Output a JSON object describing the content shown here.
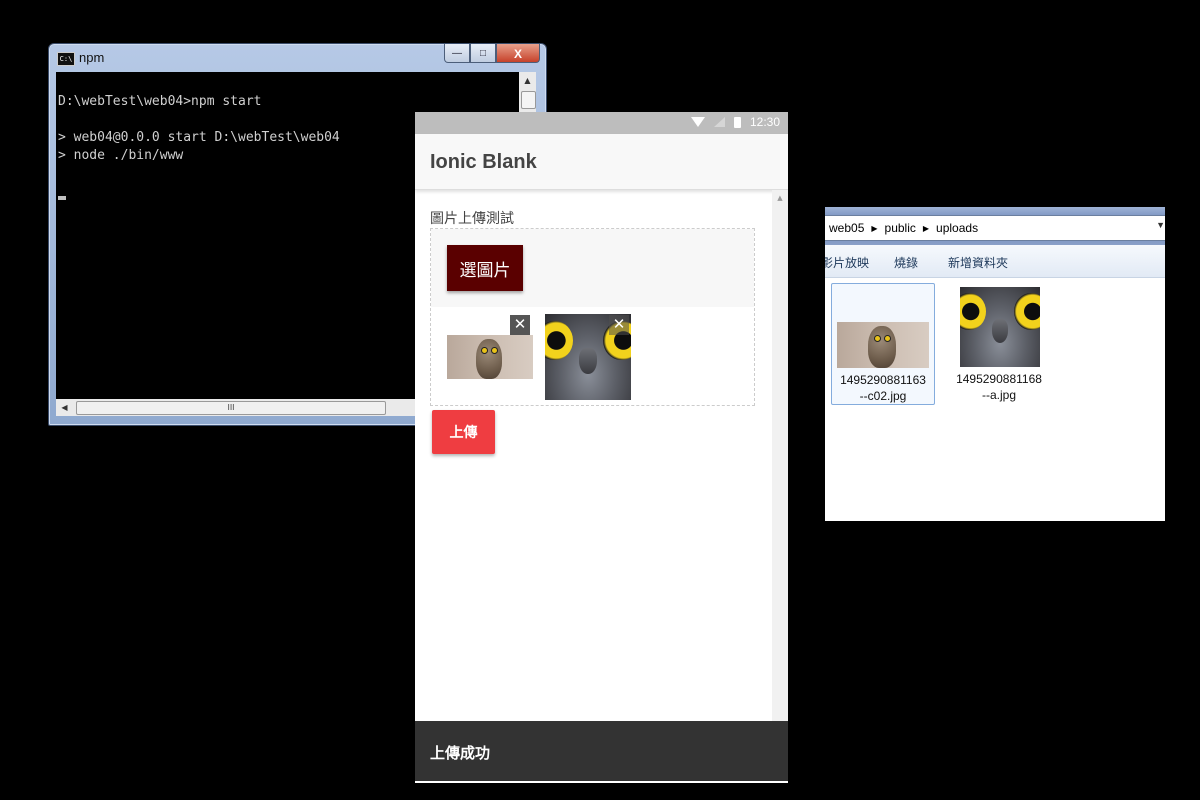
{
  "console": {
    "title": "npm",
    "app_icon": "C:\\",
    "lines": [
      "D:\\webTest\\web04>npm start",
      "",
      "> web04@0.0.0 start D:\\webTest\\web04",
      "> node ./bin/www"
    ],
    "scroll_thumb_grip": "III",
    "buttons": {
      "minimize": "—",
      "maximize": "□",
      "close": "X"
    }
  },
  "android": {
    "status_time": "12:30",
    "app_title": "Ionic Blank",
    "section_label": "圖片上傳測試",
    "choose_button": "選圖片",
    "upload_button": "上傳",
    "toast": "上傳成功",
    "thumbnails": [
      {
        "icon": "owl-full-body-photo",
        "remove": "✕"
      },
      {
        "icon": "owl-eyes-closeup-photo",
        "remove": "✕"
      }
    ]
  },
  "explorer": {
    "breadcrumbs": [
      "web05",
      "public",
      "uploads"
    ],
    "toolbar": [
      "影片放映",
      "燒錄",
      "新增資料夾"
    ],
    "files": [
      {
        "name_line1": "1495290881163",
        "name_line2": "--c02.jpg",
        "selected": true
      },
      {
        "name_line1": "1495290881168",
        "name_line2": "--a.jpg",
        "selected": false
      }
    ]
  },
  "colors": {
    "choose_button": "#5a0000",
    "upload_button": "#ef3d41",
    "toast_bg": "#333333",
    "status_bar": "#bdbdbd"
  }
}
